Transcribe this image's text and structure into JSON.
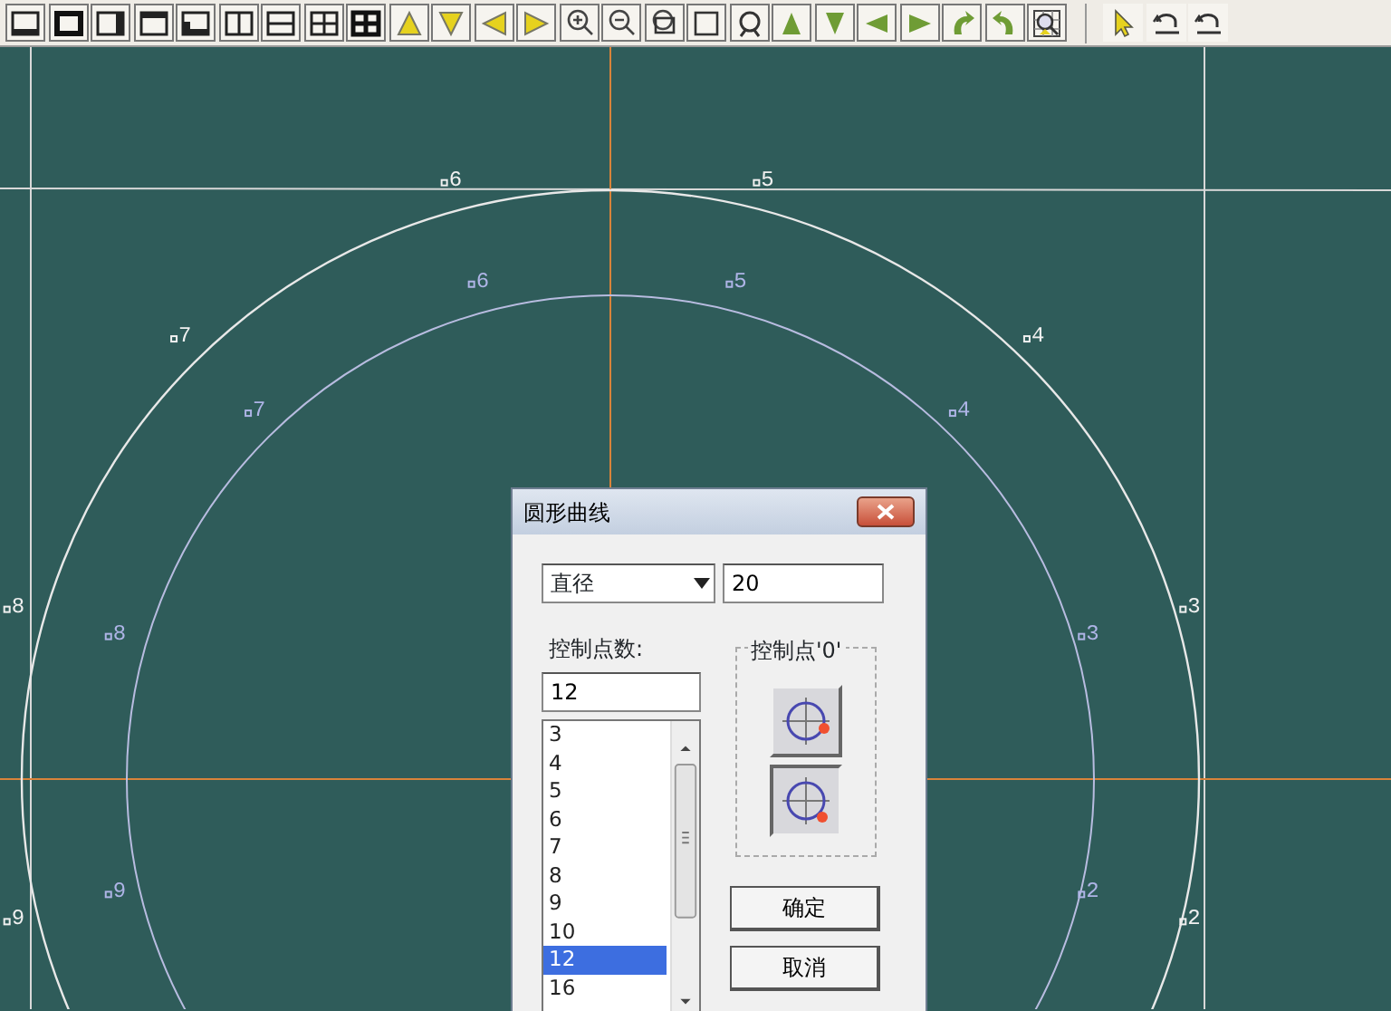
{
  "canvas": {
    "outer_points": [
      {
        "label": "2"
      },
      {
        "label": "3"
      },
      {
        "label": "4"
      },
      {
        "label": "5"
      },
      {
        "label": "6"
      },
      {
        "label": "7"
      },
      {
        "label": "8"
      },
      {
        "label": "9"
      }
    ],
    "inner_points": [
      {
        "label": "2"
      },
      {
        "label": "3"
      },
      {
        "label": "4"
      },
      {
        "label": "5"
      },
      {
        "label": "6"
      },
      {
        "label": "7"
      },
      {
        "label": "8"
      },
      {
        "label": "9"
      }
    ]
  },
  "dialog": {
    "title": "圆形曲线",
    "size_type": "直径",
    "size_value": "20",
    "count_label": "控制点数:",
    "count_value": "12",
    "count_options": [
      {
        "label": "3",
        "selected": false
      },
      {
        "label": "4",
        "selected": false
      },
      {
        "label": "5",
        "selected": false
      },
      {
        "label": "6",
        "selected": false
      },
      {
        "label": "7",
        "selected": false
      },
      {
        "label": "8",
        "selected": false
      },
      {
        "label": "9",
        "selected": false
      },
      {
        "label": "10",
        "selected": false
      },
      {
        "label": "12",
        "selected": true
      },
      {
        "label": "16",
        "selected": false
      }
    ],
    "group_title": "控制点'0'",
    "start_options": [
      {
        "kind": "right",
        "selected": false
      },
      {
        "kind": "lower-right",
        "selected": true
      }
    ],
    "buttons": [
      "确定",
      "取消"
    ]
  }
}
